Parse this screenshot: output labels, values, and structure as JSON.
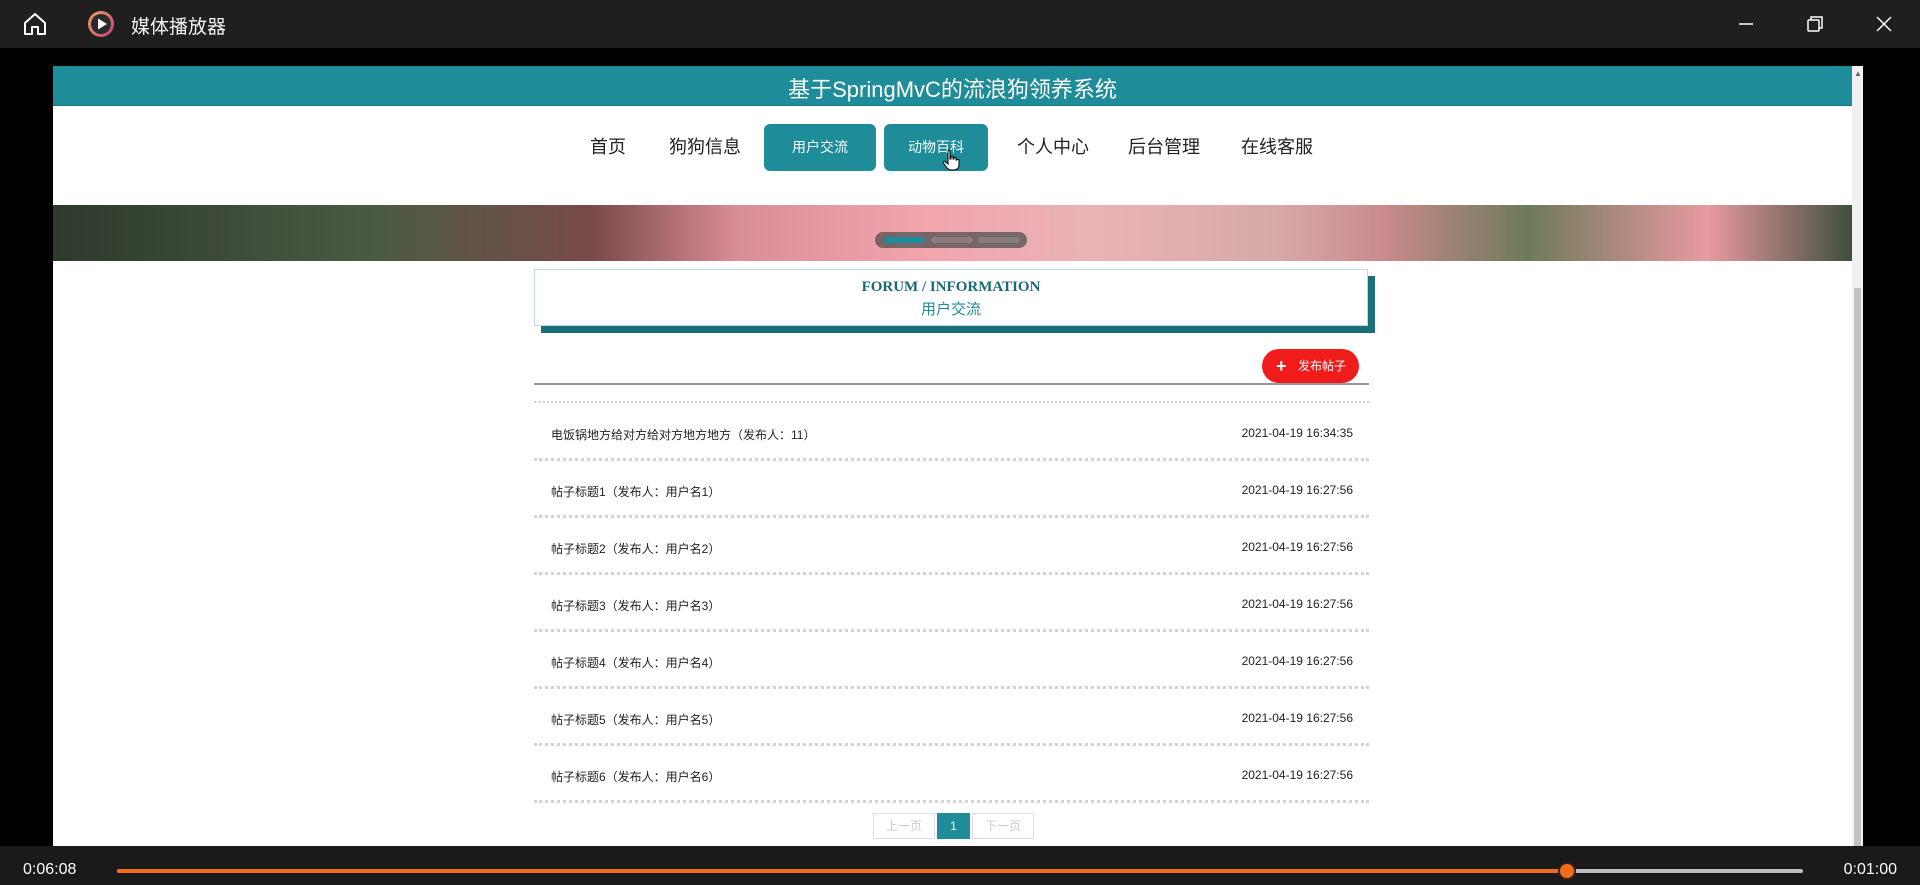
{
  "window": {
    "title": "媒体播放器",
    "icons": {
      "home": "home-icon",
      "app": "play-circle-icon",
      "minimize": "minimize-icon",
      "maximize": "restore-icon",
      "close": "close-icon"
    }
  },
  "site": {
    "title": "基于SpringMvC的流浪狗领养系统",
    "nav": [
      {
        "label": "首页",
        "active": false
      },
      {
        "label": "狗狗信息",
        "active": false
      },
      {
        "label": "用户交流",
        "active": true
      },
      {
        "label": "动物百科",
        "active": true
      },
      {
        "label": "个人中心",
        "active": false
      },
      {
        "label": "后台管理",
        "active": false
      },
      {
        "label": "在线客服",
        "active": false
      }
    ],
    "banner": {
      "slides": 3,
      "current": 1
    }
  },
  "forum": {
    "heading_en": "FORUM / INFORMATION",
    "heading_cn": "用户交流",
    "post_button": "发布帖子",
    "posts": [
      {
        "title": "电饭锅地方给对方给对方地方地方（发布人：11）",
        "time": "2021-04-19 16:34:35"
      },
      {
        "title": "帖子标题1（发布人：用户名1）",
        "time": "2021-04-19 16:27:56"
      },
      {
        "title": "帖子标题2（发布人：用户名2）",
        "time": "2021-04-19 16:27:56"
      },
      {
        "title": "帖子标题3（发布人：用户名3）",
        "time": "2021-04-19 16:27:56"
      },
      {
        "title": "帖子标题4（发布人：用户名4）",
        "time": "2021-04-19 16:27:56"
      },
      {
        "title": "帖子标题5（发布人：用户名5）",
        "time": "2021-04-19 16:27:56"
      },
      {
        "title": "帖子标题6（发布人：用户名6）",
        "time": "2021-04-19 16:27:56"
      }
    ],
    "pagination": {
      "prev": "上一页",
      "current": "1",
      "next": "下一页"
    }
  },
  "player": {
    "elapsed": "0:06:08",
    "remaining": "0:01:00",
    "progress": 0.86,
    "accent_color": "#f36b1c"
  },
  "colors": {
    "brand": "#1e8c99",
    "post_button": "#f01c1c"
  }
}
